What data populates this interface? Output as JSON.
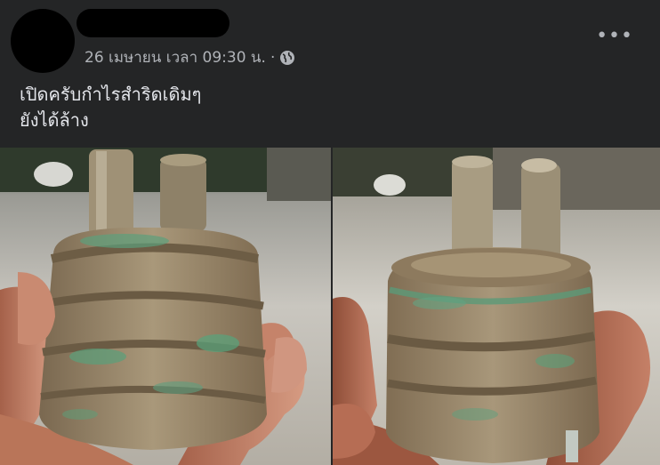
{
  "post": {
    "timestamp": "26 เมษายน เวลา 09:30 น.",
    "separator": "·",
    "privacy_icon": "globe-icon",
    "more_icon": "more-options-icon",
    "more_label": "•••",
    "text_lines": [
      "เปิดครับกำไรสำริดเดิมๆ",
      "ยังได้ล้าง"
    ]
  },
  "photos": [
    {
      "subject": "bronze-artifact-front"
    },
    {
      "subject": "bronze-artifact-side"
    }
  ],
  "colors": {
    "background": "#242526",
    "primary_text": "#e4e6eb",
    "secondary_text": "#b0b3b8",
    "bronze": "#8f7a5c",
    "patina": "#4fa07a"
  }
}
